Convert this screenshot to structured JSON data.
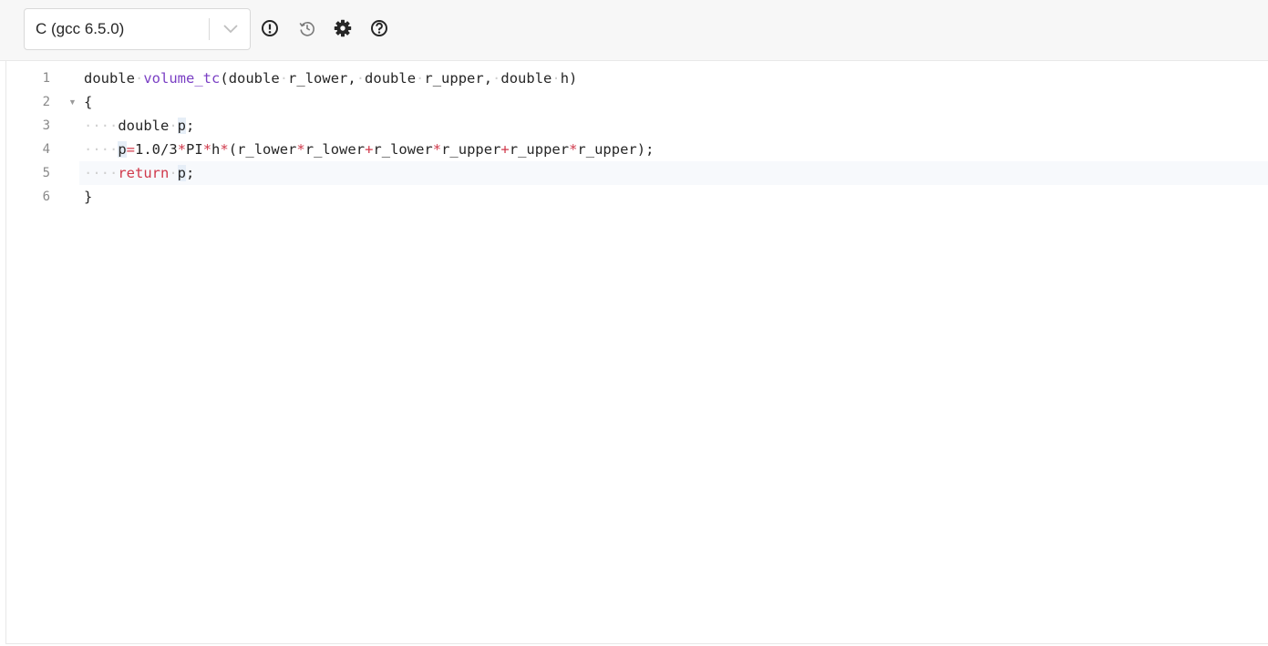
{
  "toolbar": {
    "language": "C (gcc 6.5.0)",
    "icons": [
      "alert-circle-icon",
      "history-icon",
      "settings-gear-icon",
      "help-circle-icon"
    ]
  },
  "editor": {
    "line_numbers": [
      "1",
      "2",
      "3",
      "4",
      "5",
      "6"
    ],
    "tokens": {
      "l1_type": "double",
      "l1_fn": "volume_tc",
      "l1_open": "(",
      "l1_t1": "double",
      "l1_p1": "r_lower,",
      "l1_t2": "double",
      "l1_p2": "r_upper,",
      "l1_t3": "double",
      "l1_p3": "h)",
      "l2_brace": "{",
      "l3_type": "double",
      "l3_var": "p",
      "l3_semi": ";",
      "l4_var": "p",
      "l4_eq": "=",
      "l4_num": "1.0/3",
      "l4_op1": "*",
      "l4_pi": "PI",
      "l4_op2": "*",
      "l4_h": "h",
      "l4_op3": "*",
      "l4_open": "(r_lower",
      "l4_op4": "*",
      "l4_a": "r_lower",
      "l4_op5": "+",
      "l4_b": "r_lower",
      "l4_op6": "*",
      "l4_c": "r_upper",
      "l4_op7": "+",
      "l4_d": "r_upper",
      "l4_op8": "*",
      "l4_e": "r_upper);",
      "l5_kw": "return",
      "l5_var": "p",
      "l5_semi": ";",
      "l6_brace": "}"
    },
    "indent_dots": "····",
    "space_dot": "·",
    "active_line": "5",
    "colors": {
      "function": "#7a3fc4",
      "keyword": "#d0394b",
      "operator": "#d0394b"
    }
  }
}
